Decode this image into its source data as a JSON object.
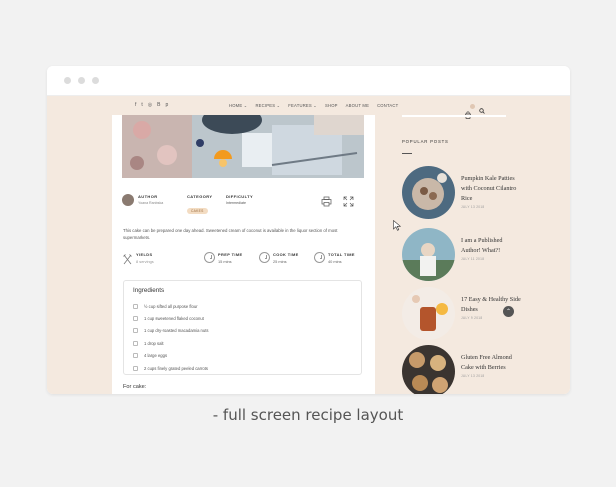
{
  "browser": {
    "window_dots": 3
  },
  "nav": {
    "social_icons": [
      "facebook-icon",
      "twitter-icon",
      "instagram-icon",
      "bloglovin-icon",
      "pinterest-icon"
    ],
    "menu": [
      "HOME ⌄",
      "RECIPES ⌄",
      "FEATURES ⌄",
      "SHOP",
      "ABOUT ME",
      "CONTACT"
    ]
  },
  "recipe": {
    "meta": {
      "author_label": "AUTHOR",
      "author_name": "Yoana Ranbska",
      "category_label": "CATEGORY",
      "category_value": "CAKES",
      "difficulty_label": "DIFFICULTY",
      "difficulty_value": "Intermediate"
    },
    "intro": "This cake can be prepared one day ahead. Sweetened cream of coconut is available in the liquor section of most supermarkets.",
    "times": {
      "yields_label": "YIELDS",
      "yields_value": "8 servings",
      "prep_label": "PREP TIME",
      "prep_value": "15 mins",
      "cook_label": "COOK TIME",
      "cook_value": "25 mins",
      "total_label": "TOTAL TIME",
      "total_value": "40 mins"
    },
    "ingredients_title": "Ingredients",
    "ingredients": [
      "½ cup sifted all purpose flour",
      "1 cup sweetened flaked coconut",
      "1 cup dry-roasted macadamia nuts",
      "1 drop salt",
      "4 large eggs",
      "2 cups finely grated peeled carrots"
    ],
    "for_cake": "For cake:"
  },
  "sidebar": {
    "popular_title": "POPULAR POSTS",
    "posts": [
      {
        "title": "Pumpkin Kale Patties with Coconut Cilantro Rice",
        "date": "JULY 13 2018"
      },
      {
        "title": "I am a Published Author! What?!",
        "date": "JULY 11 2018"
      },
      {
        "title": "17 Easy & Healthy Side Dishes",
        "date": "JULY 9 2018"
      },
      {
        "title": "Gluten Free Almond Cake with Berries",
        "date": "JULY 13 2018"
      }
    ]
  },
  "caption": "- full screen recipe layout",
  "colors": {
    "page_bg": "#f2f2f2",
    "site_bg": "#f4e9df",
    "accent_pill": "#f3dcc2"
  }
}
